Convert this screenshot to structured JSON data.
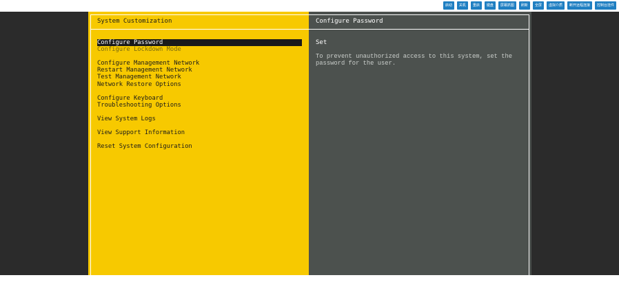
{
  "toolbar": {
    "buttons": [
      "启动",
      "关机",
      "重启",
      "键盘",
      "屏幕抓图",
      "刷新",
      "全屏",
      "虚拟介质",
      "断开远程连接",
      "控制台挂件"
    ]
  },
  "left_panel": {
    "title": "System Customization",
    "menu": [
      {
        "label": "Configure Password",
        "state": "selected"
      },
      {
        "label": "Configure Lockdown Mode",
        "state": "dim"
      },
      {
        "gap": true
      },
      {
        "label": "Configure Management Network"
      },
      {
        "label": "Restart Management Network"
      },
      {
        "label": "Test Management Network"
      },
      {
        "label": "Network Restore Options"
      },
      {
        "gap": true
      },
      {
        "label": "Configure Keyboard"
      },
      {
        "label": "Troubleshooting Options"
      },
      {
        "gap": true
      },
      {
        "label": "View System Logs"
      },
      {
        "gap": true
      },
      {
        "label": "View Support Information"
      },
      {
        "gap": true
      },
      {
        "label": "Reset System Configuration"
      }
    ]
  },
  "right_panel": {
    "title": "Configure Password",
    "heading": "Set",
    "description": "To prevent unauthorized access to this system, set the\npassword for the user."
  },
  "colors": {
    "toolbar_button": "#1f7fc2",
    "left_panel_bg": "#f7c900",
    "right_panel_bg": "#4c514e",
    "console_bg": "#2b2b2b"
  }
}
